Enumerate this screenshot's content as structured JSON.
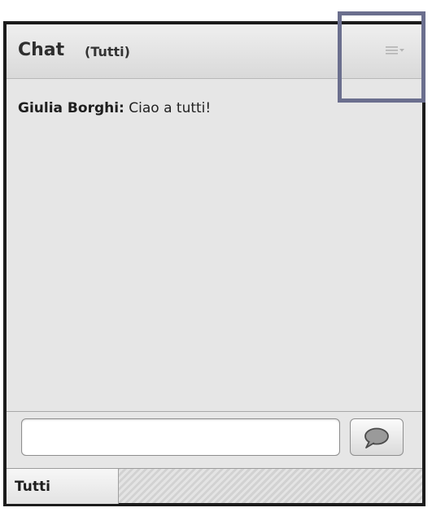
{
  "header": {
    "title": "Chat",
    "scope": "(Tutti)",
    "menu_icon": "hamburger-menu-icon"
  },
  "messages": [
    {
      "author": "Giulia Borghi:",
      "text": "Ciao a tutti!"
    }
  ],
  "composer": {
    "input_value": "",
    "send_icon": "speech-bubble-icon"
  },
  "tabs": [
    {
      "label": "Tutti",
      "active": true
    }
  ],
  "colors": {
    "highlight_border": "#6b6f8e",
    "header_bg": "#e3e3e3",
    "panel_bg": "#e6e6e6"
  }
}
